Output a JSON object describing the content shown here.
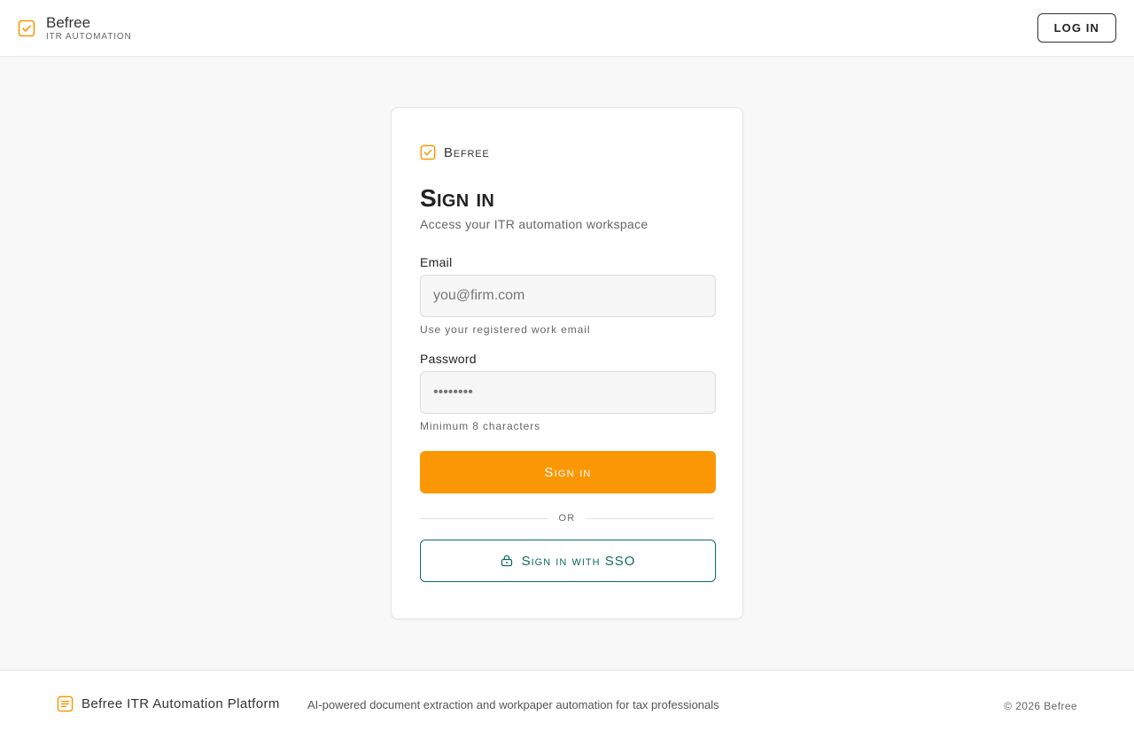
{
  "header": {
    "brand_name": "Befree",
    "brand_subtitle": "ITR AUTOMATION",
    "login_label": "LOG IN"
  },
  "card": {
    "brand_name": "Befree",
    "title": "Sign in",
    "subtitle": "Access your ITR automation workspace",
    "email": {
      "label": "Email",
      "placeholder": "you@firm.com",
      "value": "",
      "hint": "Use your registered work email"
    },
    "password": {
      "label": "Password",
      "placeholder": "••••••••",
      "value": "",
      "hint": "Minimum 8 characters"
    },
    "submit_label": "Sign in",
    "divider_label": "OR",
    "sso_label": "Sign in with SSO"
  },
  "footer": {
    "brand_name": "Befree ITR Automation Platform",
    "tagline": "AI-powered document extraction and workpaper automation for tax professionals",
    "copyright": "© 2026 Befree"
  },
  "icons": {
    "brand": "check-square-icon",
    "sso": "lock-icon",
    "footer": "document-list-icon"
  },
  "colors": {
    "accent": "#fb9704",
    "sso": "#0e6b5c",
    "background": "#f8f8f8"
  }
}
